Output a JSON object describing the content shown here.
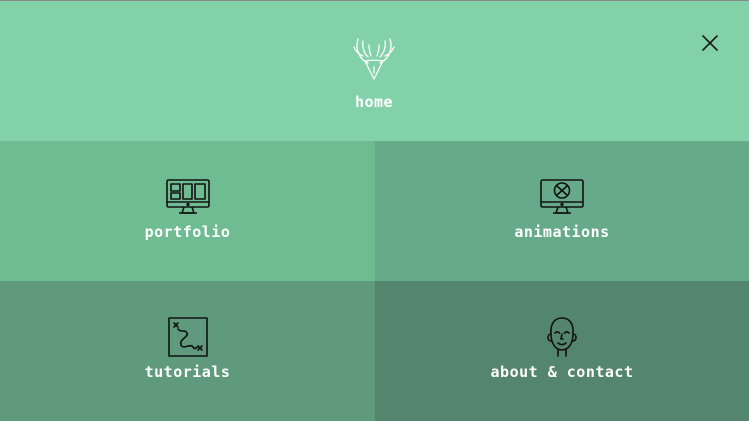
{
  "header": {
    "home_label": "home",
    "logo_icon": "antler-logo-icon",
    "close_icon": "close-icon",
    "background": "#82d1a9"
  },
  "tiles": [
    {
      "label": "portfolio",
      "icon": "monitor-grid-icon",
      "background": "#6fbc93"
    },
    {
      "label": "animations",
      "icon": "monitor-target-icon",
      "background": "#67aa89"
    },
    {
      "label": "tutorials",
      "icon": "treasure-map-icon",
      "background": "#5e9a7b"
    },
    {
      "label": "about & contact",
      "icon": "face-icon",
      "background": "#54856d"
    }
  ],
  "colors": {
    "text": "#ffffff",
    "icon_stroke": "#111111"
  }
}
